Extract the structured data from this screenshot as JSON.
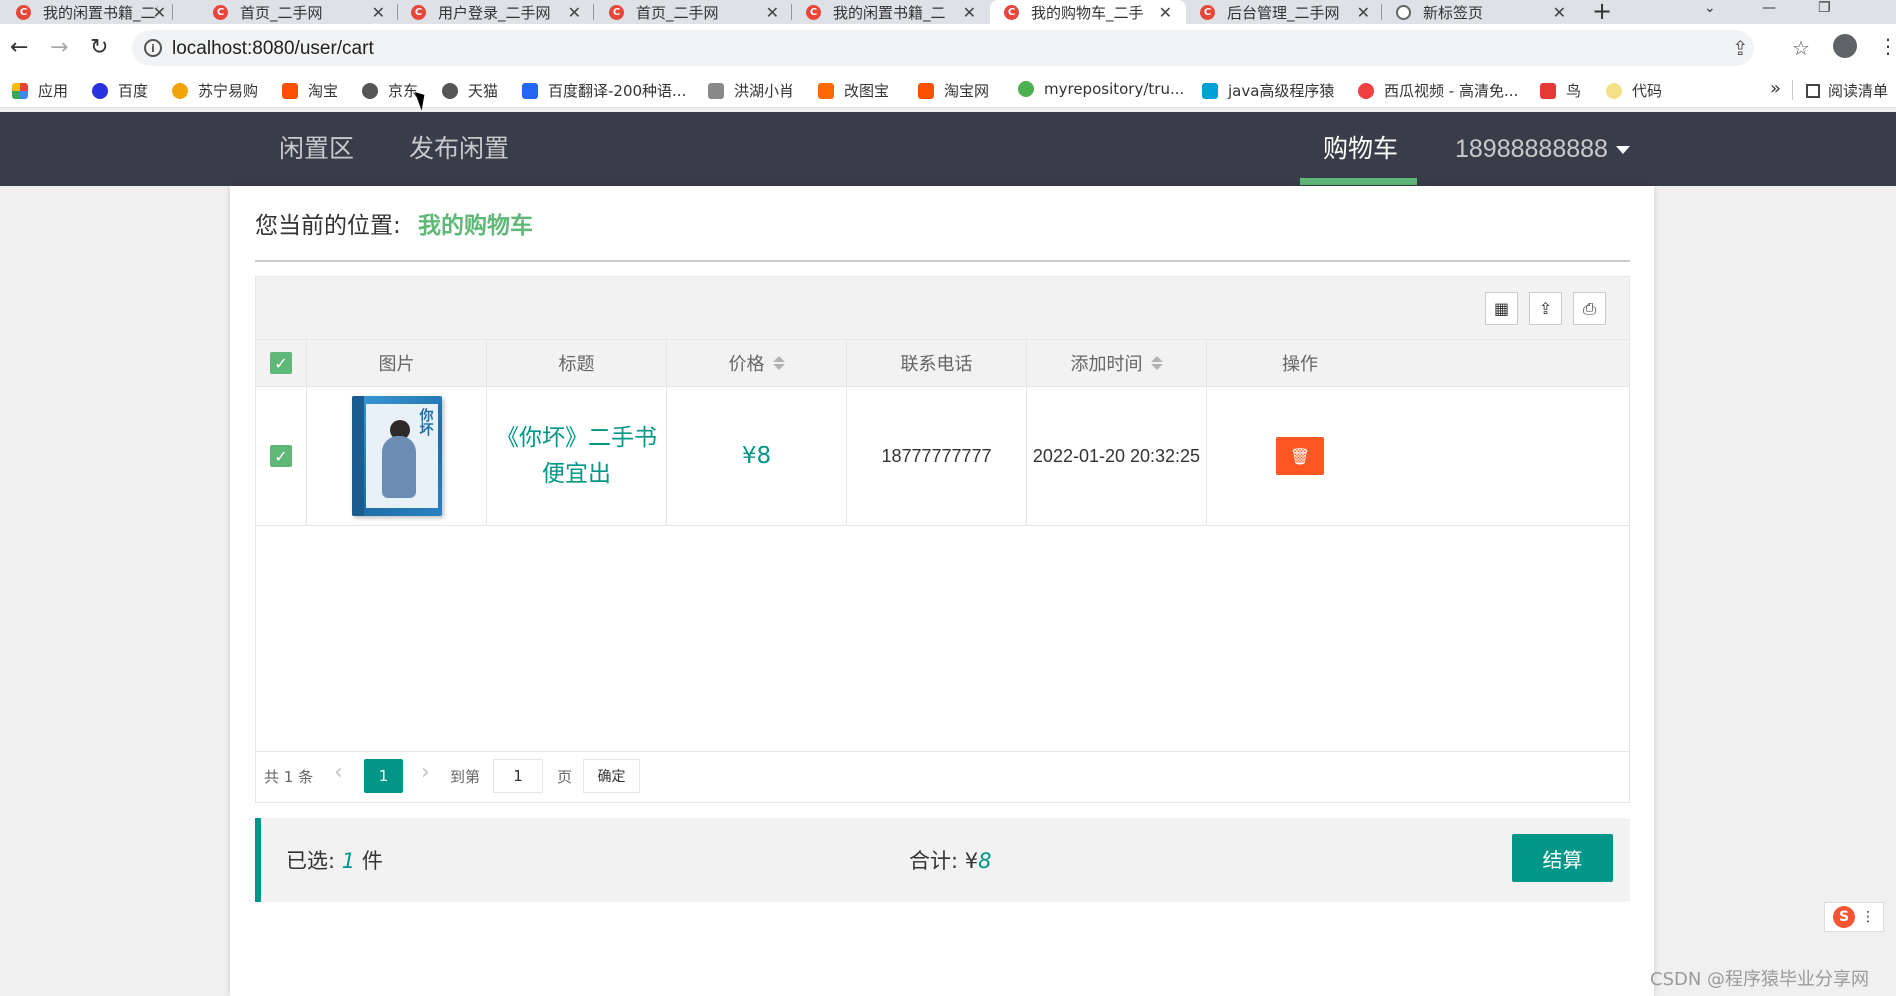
{
  "browser": {
    "tabs": [
      {
        "title": "我的闲置书籍_二手",
        "favicon": "C"
      },
      {
        "title": "首页_二手网",
        "favicon": "C"
      },
      {
        "title": "用户登录_二手网",
        "favicon": "C"
      },
      {
        "title": "首页_二手网",
        "favicon": "C"
      },
      {
        "title": "我的闲置书籍_二",
        "favicon": "C"
      },
      {
        "title": "我的购物车_二手",
        "favicon": "C"
      },
      {
        "title": "后台管理_二手网",
        "favicon": "C"
      },
      {
        "title": "新标签页",
        "favicon": "globe"
      }
    ],
    "url": "localhost:8080/user/cart",
    "bookmarks": [
      {
        "label": "应用",
        "color": "#e94235"
      },
      {
        "label": "百度",
        "color": "#2932e1"
      },
      {
        "label": "苏宁易购",
        "color": "#f0a30a"
      },
      {
        "label": "淘宝",
        "color": "#ff5000"
      },
      {
        "label": "京东",
        "color": "#555555"
      },
      {
        "label": "天猫",
        "color": "#555555"
      },
      {
        "label": "百度翻译-200种语...",
        "color": "#2468f2"
      },
      {
        "label": "洪湖小肖",
        "color": "#888888"
      },
      {
        "label": "改图宝",
        "color": "#ff6a00"
      },
      {
        "label": "淘宝网",
        "color": "#ff5000"
      },
      {
        "label": "myrepository/tru...",
        "color": "#4caf50"
      },
      {
        "label": "java高级程序猿",
        "color": "#00a1d6"
      },
      {
        "label": "西瓜视频 - 高清免...",
        "color": "#f04142"
      },
      {
        "label": "鸟",
        "color": "#e53935"
      },
      {
        "label": "代码",
        "color": "#f5e08a"
      }
    ],
    "more_label": "»",
    "reading_list": "阅读清单"
  },
  "nav": {
    "left": [
      "闲置区",
      "发布闲置"
    ],
    "cart": "购物车",
    "user": "18988888888"
  },
  "breadcrumb": {
    "prefix": "您当前的位置:",
    "current": "我的购物车"
  },
  "table": {
    "headers": {
      "image": "图片",
      "title": "标题",
      "price": "价格",
      "phone": "联系电话",
      "time": "添加时间",
      "action": "操作"
    },
    "rows": [
      {
        "checked": true,
        "cover_text": "你坏",
        "title_line1": "《你坏》二手书",
        "title_line2": "便宜出",
        "price": "¥8",
        "phone": "18777777777",
        "time": "2022-01-20 20:32:25"
      }
    ]
  },
  "pager": {
    "total": "共 1 条",
    "current_page": "1",
    "goto_label": "到第",
    "goto_value": "1",
    "page_unit": "页",
    "confirm": "确定"
  },
  "summary": {
    "selected_label": "已选:",
    "selected_count": "1",
    "selected_unit": "件",
    "total_label": "合计: ¥",
    "total_value": "8",
    "checkout": "结算"
  },
  "watermark": "CSDN @程序猿毕业分享网",
  "colors": {
    "nav_bg": "#393d49",
    "accent_green": "#5fb878",
    "teal": "#009688",
    "danger": "#ff5722"
  }
}
